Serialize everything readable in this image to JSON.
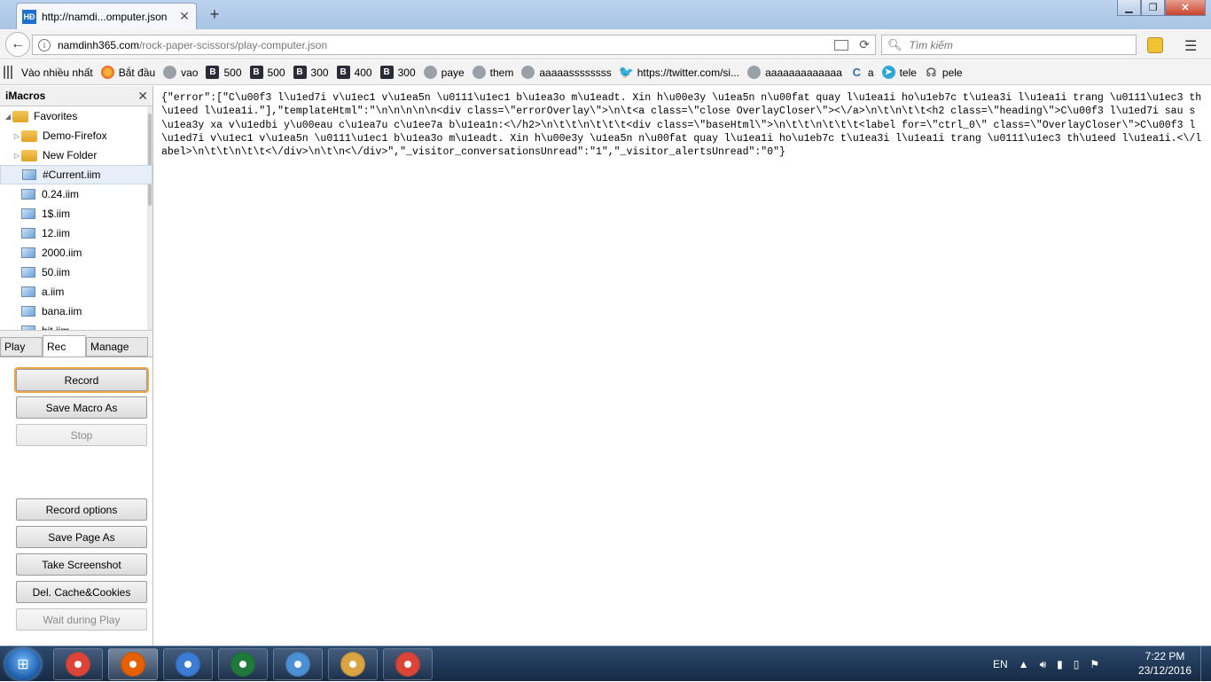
{
  "browser": {
    "tab_title": "http://namdi...omputer.json",
    "tab_favicon": "HĐ",
    "url_host": "namdinh365.com",
    "url_path": "/rock-paper-scissors/play-computer.json",
    "search_placeholder": "Tìm kiếm"
  },
  "bookmarks": [
    {
      "label": "Vào nhiều nhất",
      "icon": "most-visited-icon",
      "glyph": ""
    },
    {
      "label": "Bắt đầu",
      "icon": "firefox-icon",
      "glyph": ""
    },
    {
      "label": "vao",
      "icon": "globe-icon",
      "glyph": ""
    },
    {
      "label": "500",
      "icon": "b-icon",
      "glyph": "B"
    },
    {
      "label": "500",
      "icon": "b-icon",
      "glyph": "B"
    },
    {
      "label": "300",
      "icon": "b-icon",
      "glyph": "B"
    },
    {
      "label": "400",
      "icon": "b-icon",
      "glyph": "B"
    },
    {
      "label": "300",
      "icon": "b-icon",
      "glyph": "B"
    },
    {
      "label": "paye",
      "icon": "globe-icon",
      "glyph": ""
    },
    {
      "label": "them",
      "icon": "globe-icon",
      "glyph": ""
    },
    {
      "label": "aaaaassssssss",
      "icon": "globe-icon",
      "glyph": ""
    },
    {
      "label": "https://twitter.com/si...",
      "icon": "twitter-icon",
      "glyph": "🐦"
    },
    {
      "label": "aaaaaaaaaaaaa",
      "icon": "globe-icon",
      "glyph": ""
    },
    {
      "label": "a",
      "icon": "c-icon",
      "glyph": "C"
    },
    {
      "label": "tele",
      "icon": "telegram-icon",
      "glyph": "➤"
    },
    {
      "label": "pele",
      "icon": "pele-icon",
      "glyph": "☊"
    }
  ],
  "imacros": {
    "title": "iMacros",
    "tree": [
      {
        "label": "Favorites",
        "type": "folder",
        "twisty": "◢",
        "indent": 0
      },
      {
        "label": "Demo-Firefox",
        "type": "folder",
        "twisty": "▷",
        "indent": 1
      },
      {
        "label": "New Folder",
        "type": "folder",
        "twisty": "▷",
        "indent": 1
      },
      {
        "label": "#Current.iim",
        "type": "file",
        "twisty": "",
        "indent": 1,
        "selected": true
      },
      {
        "label": "0.24.iim",
        "type": "file",
        "twisty": "",
        "indent": 1
      },
      {
        "label": "1$.iim",
        "type": "file",
        "twisty": "",
        "indent": 1
      },
      {
        "label": "12.iim",
        "type": "file",
        "twisty": "",
        "indent": 1
      },
      {
        "label": "2000.iim",
        "type": "file",
        "twisty": "",
        "indent": 1
      },
      {
        "label": "50.iim",
        "type": "file",
        "twisty": "",
        "indent": 1
      },
      {
        "label": "a.iim",
        "type": "file",
        "twisty": "",
        "indent": 1
      },
      {
        "label": "bana.iim",
        "type": "file",
        "twisty": "",
        "indent": 1
      },
      {
        "label": "bit.iim",
        "type": "file",
        "twisty": "",
        "indent": 1
      }
    ],
    "tabs": [
      "Play",
      "Rec",
      "Manage"
    ],
    "active_tab": "Rec",
    "buttons": {
      "record": "Record",
      "save_macro_as": "Save Macro As",
      "stop": "Stop",
      "record_options": "Record options",
      "save_page_as": "Save Page As",
      "take_screenshot": "Take Screenshot",
      "del_cache_cookies": "Del. Cache&Cookies",
      "wait_during_play": "Wait during Play"
    }
  },
  "json_content": "{\"error\":[\"C\\u00f3 l\\u1ed7i v\\u1ec1 v\\u1ea5n \\u0111\\u1ec1 b\\u1ea3o m\\u1eadt. Xin h\\u00e3y \\u1ea5n n\\u00fat quay l\\u1ea1i ho\\u1eb7c t\\u1ea3i l\\u1ea1i trang \\u0111\\u1ec3 th\\u1eed l\\u1ea1i.\"],\"templateHtml\":\"\\n\\n\\n\\n\\n<div class=\\\"errorOverlay\\\">\\n\\t<a class=\\\"close OverlayCloser\\\"><\\/a>\\n\\t\\n\\t\\t<h2 class=\\\"heading\\\">C\\u00f3 l\\u1ed7i sau s\\u1ea3y xa v\\u1edbi y\\u00eau c\\u1ea7u c\\u1ee7a b\\u1ea1n:<\\/h2>\\n\\t\\t\\n\\t\\t\\t<div class=\\\"baseHtml\\\">\\n\\t\\t\\n\\t\\t\\t<label for=\\\"ctrl_0\\\" class=\\\"OverlayCloser\\\">C\\u00f3 l\\u1ed7i v\\u1ec1 v\\u1ea5n \\u0111\\u1ec1 b\\u1ea3o m\\u1eadt. Xin h\\u00e3y \\u1ea5n n\\u00fat quay l\\u1ea1i ho\\u1eb7c t\\u1ea3i l\\u1ea1i trang \\u0111\\u1ec3 th\\u1eed l\\u1ea1i.<\\/label>\\n\\t\\t\\n\\t\\t<\\/div>\\n\\t\\n<\\/div>\",\"_visitor_conversationsUnread\":\"1\",\"_visitor_alertsUnread\":\"0\"}",
  "taskbar": {
    "language": "EN",
    "time": "7:22 PM",
    "date": "23/12/2016",
    "apps": [
      {
        "name": "chrome",
        "color": "#db4437"
      },
      {
        "name": "firefox",
        "color": "#e66000",
        "active": true
      },
      {
        "name": "remote",
        "color": "#3a7bd5"
      },
      {
        "name": "excel",
        "color": "#1d7a3a"
      },
      {
        "name": "photos",
        "color": "#4b8fd6"
      },
      {
        "name": "paint",
        "color": "#d9a441"
      },
      {
        "name": "chrome2",
        "color": "#db4437"
      }
    ]
  }
}
